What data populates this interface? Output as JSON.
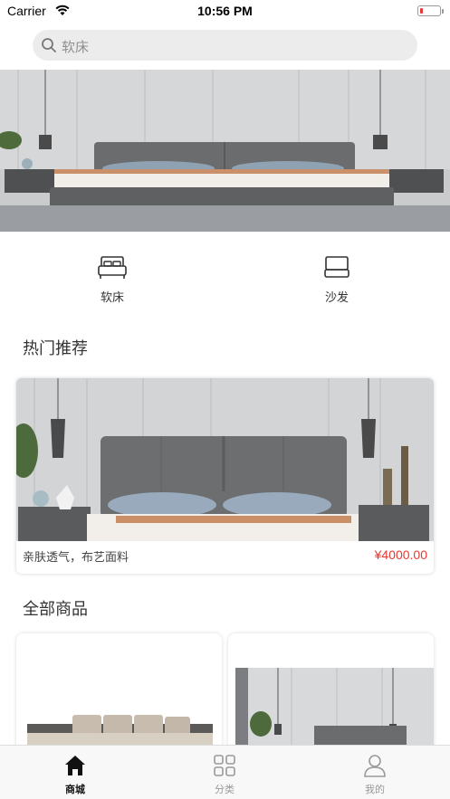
{
  "status_bar": {
    "carrier": "Carrier",
    "time": "10:56 PM",
    "battery_color": "#e53935"
  },
  "search": {
    "placeholder": "软床"
  },
  "categories": [
    {
      "label": "软床",
      "icon": "bed-icon"
    },
    {
      "label": "沙发",
      "icon": "sofa-icon"
    }
  ],
  "hot_section": {
    "title": "热门推荐",
    "items": [
      {
        "desc": "亲肤透气，布艺面料",
        "price": "¥4000.00"
      }
    ]
  },
  "all_section": {
    "title": "全部商品"
  },
  "tabs": [
    {
      "label": "商城",
      "icon": "home-icon",
      "active": true
    },
    {
      "label": "分类",
      "icon": "grid-icon",
      "active": false
    },
    {
      "label": "我的",
      "icon": "user-icon",
      "active": false
    }
  ],
  "colors": {
    "price": "#e53935",
    "search_bg": "#ececec",
    "tab_bg": "#f8f8f8"
  }
}
